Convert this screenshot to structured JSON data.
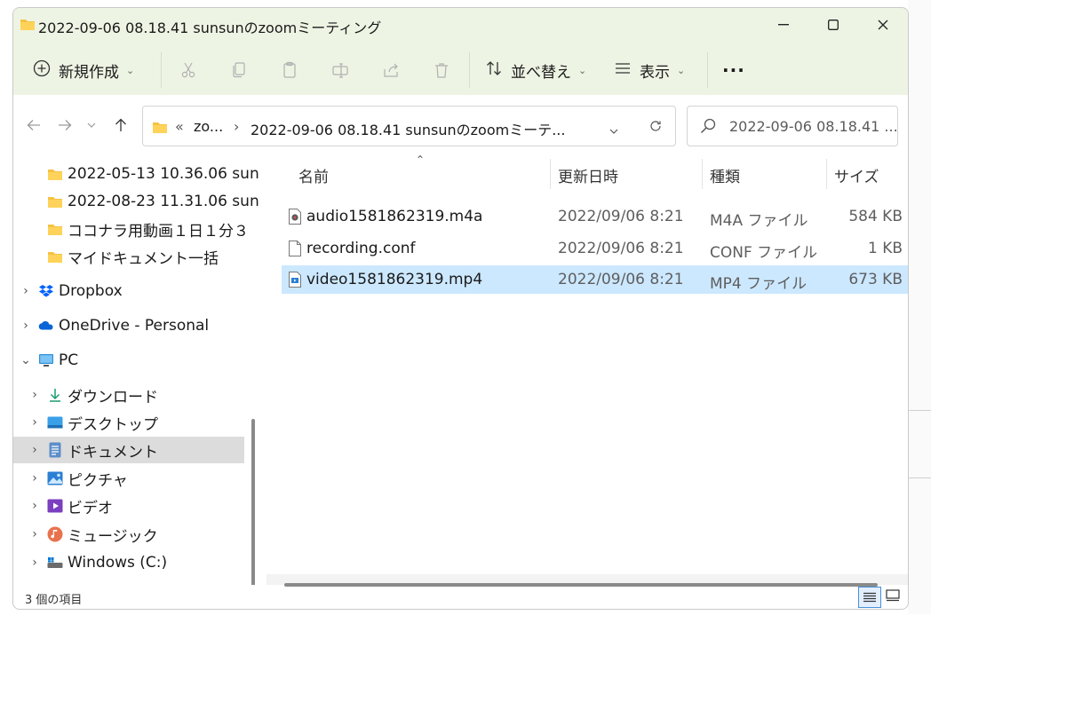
{
  "window": {
    "title": "2022-09-06 08.18.41 sunsunのzoomミーティング"
  },
  "toolbar": {
    "new_label": "新規作成",
    "sort_label": "並べ替え",
    "view_label": "表示",
    "more_label": "···"
  },
  "address": {
    "overflow": "«",
    "crumb1": "zo...",
    "sep": "›",
    "crumb2": "2022-09-06 08.18.41 sunsunのzoomミーテ..."
  },
  "search": {
    "placeholder": "2022-09-06 08.18.41 ..."
  },
  "sidebar": {
    "items": [
      {
        "label": "2022-05-13 10.36.06 sun"
      },
      {
        "label": "2022-08-23 11.31.06 sun"
      },
      {
        "label": "ココナラ用動画１日１分３"
      },
      {
        "label": "マイドキュメント一括"
      },
      {
        "label": "Dropbox"
      },
      {
        "label": "OneDrive - Personal"
      },
      {
        "label": "PC"
      },
      {
        "label": "ダウンロード"
      },
      {
        "label": "デスクトップ"
      },
      {
        "label": "ドキュメント"
      },
      {
        "label": "ピクチャ"
      },
      {
        "label": "ビデオ"
      },
      {
        "label": "ミュージック"
      },
      {
        "label": "Windows (C:)"
      }
    ]
  },
  "files": {
    "columns": [
      "名前",
      "更新日時",
      "種類",
      "サイズ"
    ],
    "rows": [
      {
        "name": "audio1581862319.m4a",
        "date": "2022/09/06 8:21",
        "type": "M4A ファイル",
        "size": "584 KB",
        "icon": "audio-file-icon"
      },
      {
        "name": "recording.conf",
        "date": "2022/09/06 8:21",
        "type": "CONF ファイル",
        "size": "1 KB",
        "icon": "text-file-icon"
      },
      {
        "name": "video1581862319.mp4",
        "date": "2022/09/06 8:21",
        "type": "MP4 ファイル",
        "size": "673 KB",
        "icon": "video-file-icon",
        "selected": true
      }
    ]
  },
  "status": {
    "count": "3 個の項目"
  },
  "colors": {
    "accent": "#0067c0",
    "toolbar_bg": "#eef4e4",
    "selection": "#cce8ff"
  }
}
